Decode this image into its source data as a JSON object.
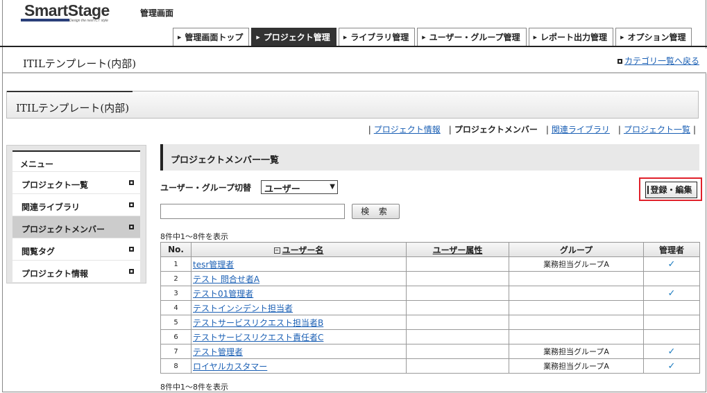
{
  "brand": {
    "name": "SmartStage",
    "tagline": "Design the next ICT style"
  },
  "header": {
    "admin_label": "管理画面"
  },
  "topnav": [
    {
      "label": "管理画面トップ",
      "active": false
    },
    {
      "label": "プロジェクト管理",
      "active": true
    },
    {
      "label": "ライブラリ管理",
      "active": false
    },
    {
      "label": "ユーザー・グループ管理",
      "active": false
    },
    {
      "label": "レポート出力管理",
      "active": false
    },
    {
      "label": "オプション管理",
      "active": false
    }
  ],
  "page": {
    "title": "ITILテンプレート(内部)",
    "back_link": "カテゴリ一覧へ戻る"
  },
  "section": {
    "title": "ITILテンプレート(内部)"
  },
  "subnav": {
    "project_info": "プロジェクト情報",
    "project_member": "プロジェクトメンバー",
    "related_library": "関連ライブラリ",
    "project_list": "プロジェクト一覧"
  },
  "side": {
    "header": "メニュー",
    "items": [
      "プロジェクト一覧",
      "関連ライブラリ",
      "プロジェクトメンバー",
      "閲覧タグ",
      "プロジェクト情報"
    ],
    "selected_index": 2
  },
  "main": {
    "title": "プロジェクトメンバー一覧",
    "switch_label": "ユーザー・グループ切替",
    "switch_value": "ユーザー",
    "register_button": "登録・編集",
    "search_value": "",
    "search_button": "検 索",
    "count_text": "8件中1～8件を表示"
  },
  "table": {
    "headers": {
      "no": "No.",
      "name": "ユーザー名",
      "attr": "ユーザー属性",
      "group": "グループ",
      "admin": "管理者"
    },
    "check_glyph": "✓",
    "rows": [
      {
        "no": "1",
        "name": "tesr管理者",
        "attr": "",
        "group": "業務担当グループA",
        "admin": true
      },
      {
        "no": "2",
        "name": "テスト 問合せ者A",
        "attr": "",
        "group": "",
        "admin": false
      },
      {
        "no": "3",
        "name": "テスト01管理者",
        "attr": "",
        "group": "",
        "admin": true
      },
      {
        "no": "4",
        "name": "テストインシデント担当者",
        "attr": "",
        "group": "",
        "admin": false
      },
      {
        "no": "5",
        "name": "テストサービスリクエスト担当者B",
        "attr": "",
        "group": "",
        "admin": false
      },
      {
        "no": "6",
        "name": "テストサービスリクエスト責任者C",
        "attr": "",
        "group": "",
        "admin": false
      },
      {
        "no": "7",
        "name": "テスト管理者",
        "attr": "",
        "group": "業務担当グループA",
        "admin": true
      },
      {
        "no": "8",
        "name": "ロイヤルカスタマー",
        "attr": "",
        "group": "業務担当グループA",
        "admin": true
      }
    ]
  }
}
